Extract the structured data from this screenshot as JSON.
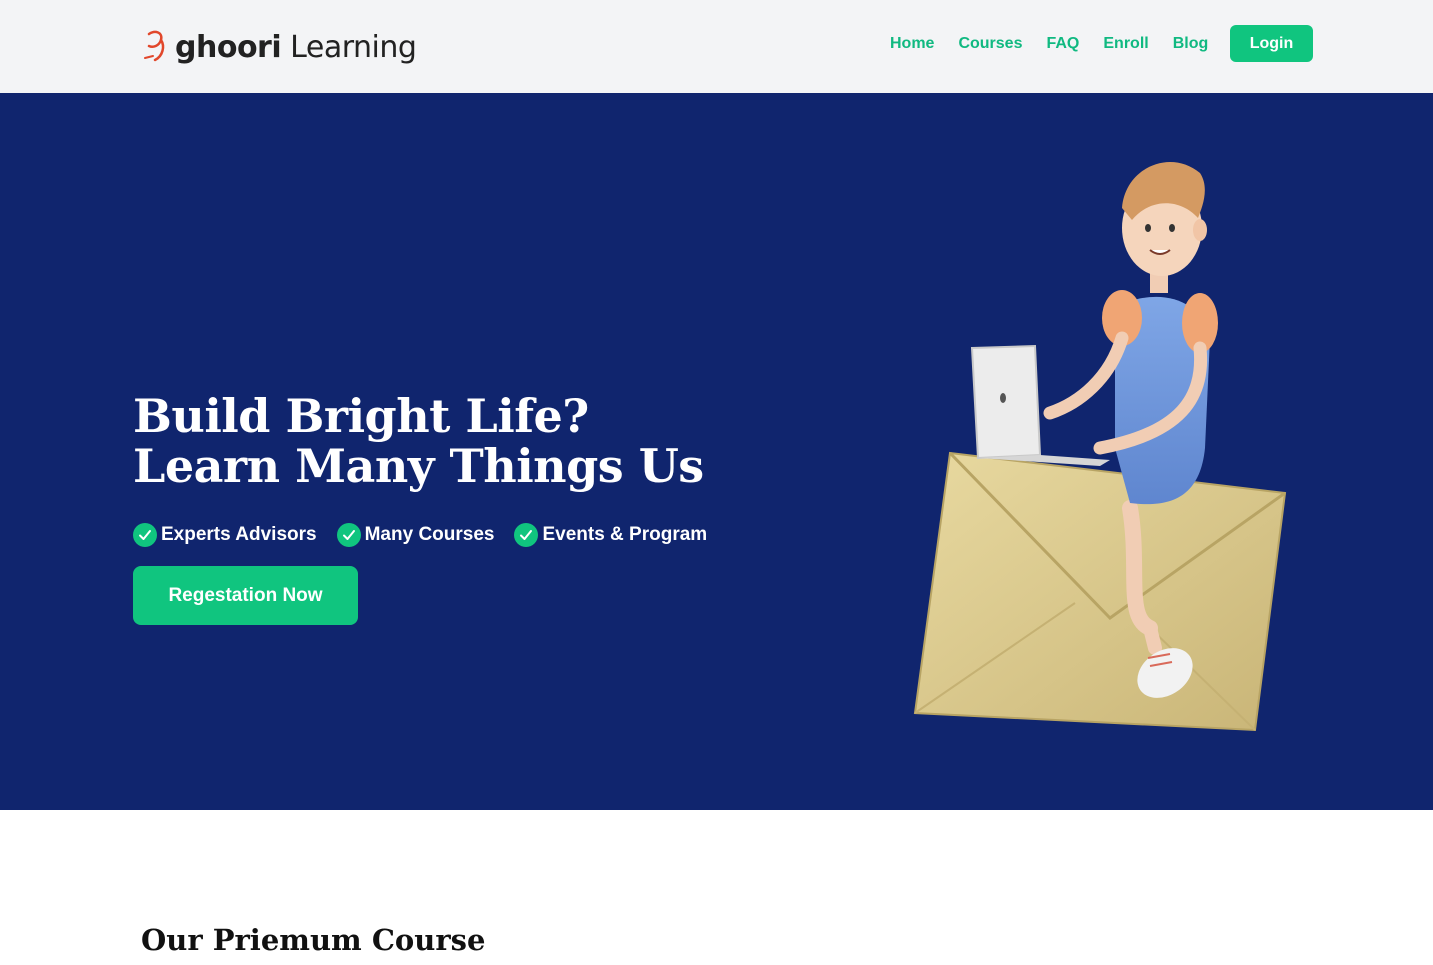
{
  "brand": {
    "name_part1": "ghoori",
    "name_part2": " Learning"
  },
  "nav": {
    "links": [
      "Home",
      "Courses",
      "FAQ",
      "Enroll",
      "Blog"
    ],
    "login_label": "Login"
  },
  "hero": {
    "title_line1": "Build Bright Life?",
    "title_line2": "Learn Many Things Us",
    "features": [
      "Experts Advisors",
      "Many Courses",
      "Events & Program"
    ],
    "cta_label": "Regestation Now"
  },
  "premium": {
    "title": "Our Priemum Course"
  },
  "colors": {
    "accent": "#10c57f",
    "nav_link": "#10b981",
    "hero_bg": "#10256e",
    "navbar_bg": "#f3f4f6"
  },
  "icons": [
    "logo-mark-icon",
    "check-circle-icon"
  ]
}
